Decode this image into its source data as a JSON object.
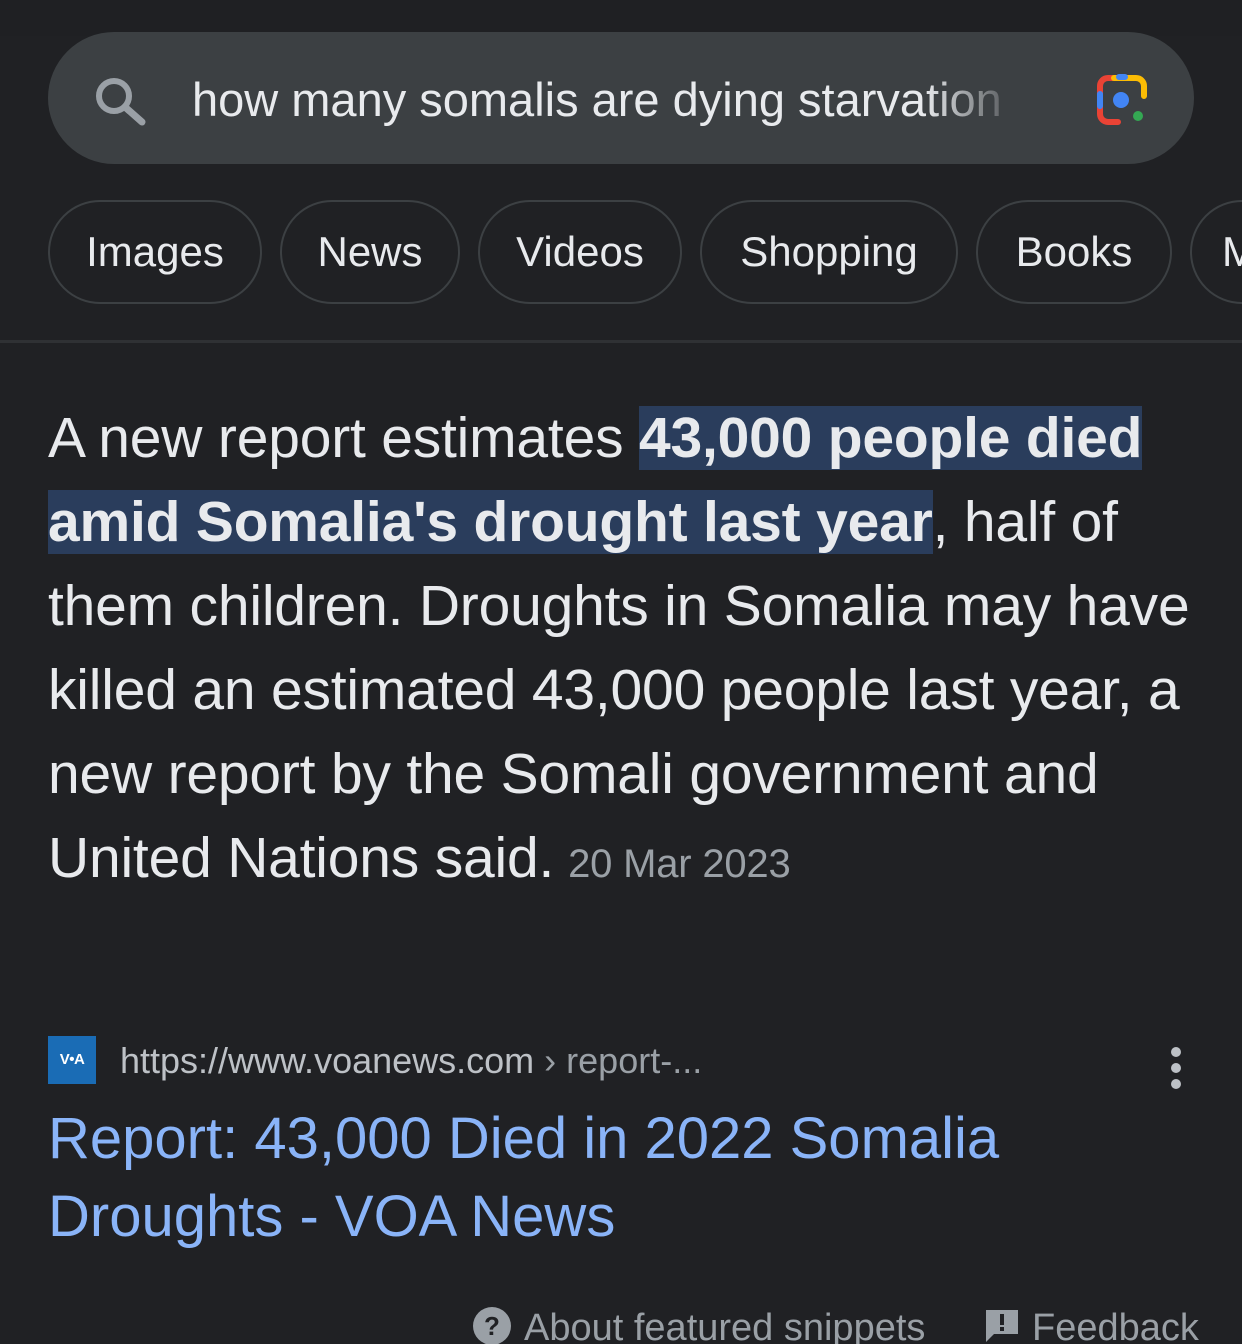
{
  "search": {
    "query": "how many somalis are dying starvation"
  },
  "chips": [
    {
      "label": "Images"
    },
    {
      "label": "News"
    },
    {
      "label": "Videos"
    },
    {
      "label": "Shopping"
    },
    {
      "label": "Books"
    },
    {
      "label": "M"
    }
  ],
  "snippet": {
    "prefix": "A new report estimates ",
    "highlight": "43,000 people died amid Somalia's drought last year",
    "body": ", half of them children. Droughts in Somalia may have killed an estimated 43,000 people last year, a new report by the Somali government and United Nations said.",
    "date": "20 Mar 2023"
  },
  "source": {
    "favicon_text": "V•A",
    "url": "https://www.voanews.com",
    "path": " › report-..."
  },
  "result": {
    "title": "Report: 43,000 Died in 2022 Somalia Droughts - VOA News"
  },
  "footer": {
    "about": "About featured snippets",
    "feedback": "Feedback"
  },
  "colors": {
    "background": "#202124",
    "search_bar": "#3c4043",
    "link": "#8ab4f8",
    "highlight": "#2a3d5c",
    "muted": "#9aa0a6"
  },
  "icons": [
    "search-icon",
    "google-lens-icon",
    "more-vert-icon",
    "help-icon",
    "feedback-icon"
  ]
}
